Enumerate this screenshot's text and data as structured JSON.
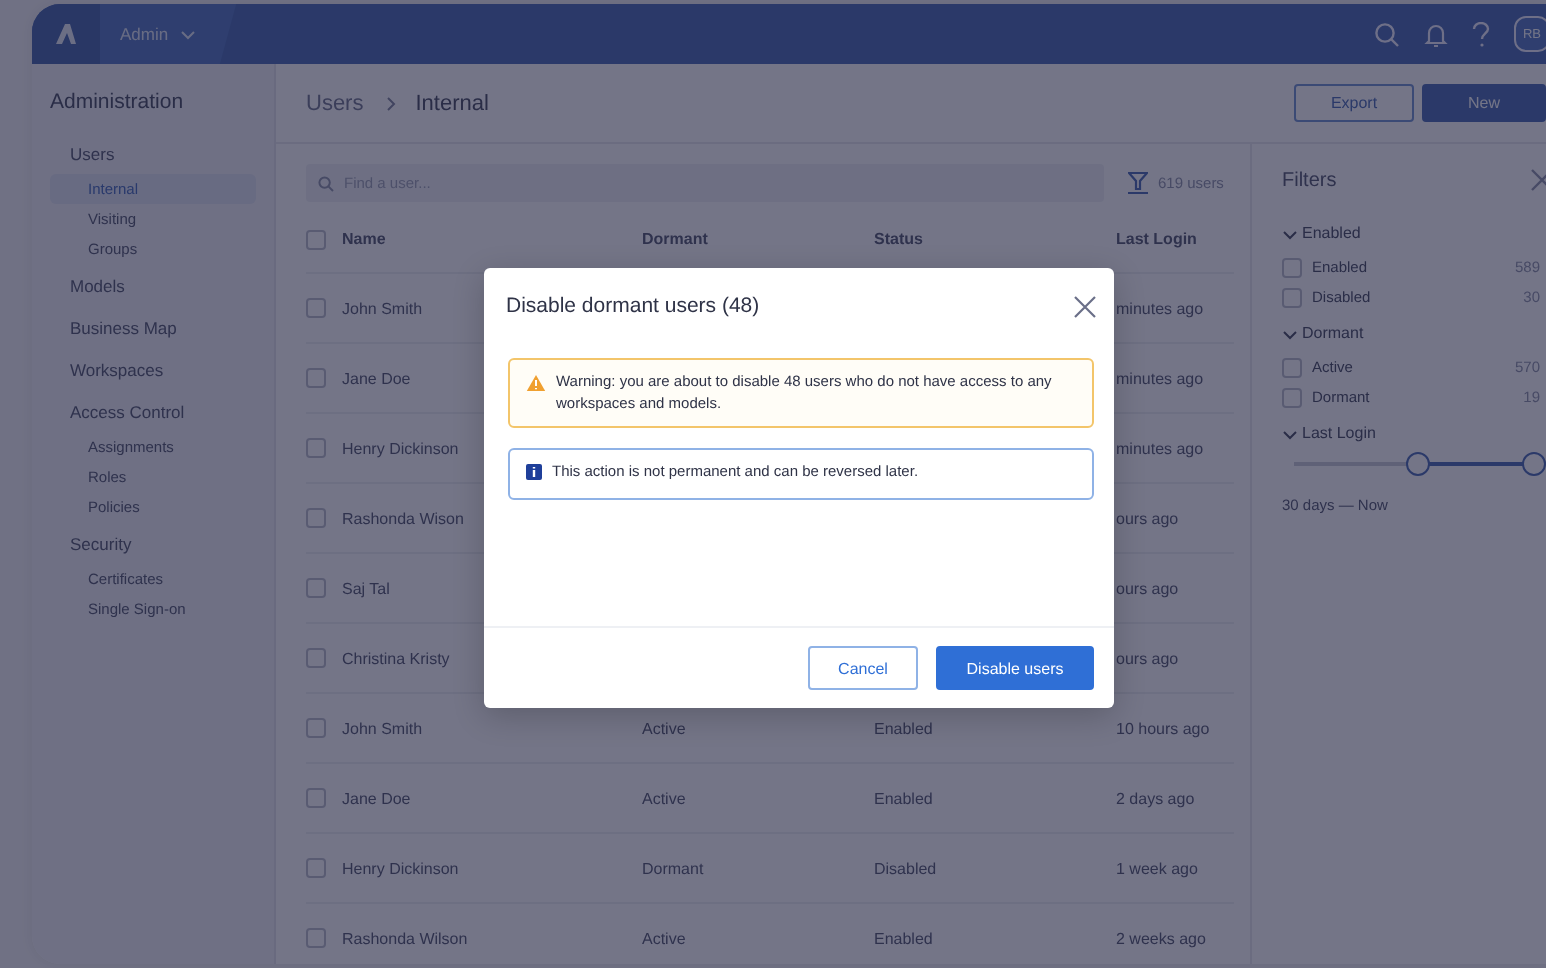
{
  "topbar": {
    "app_menu": "Admin",
    "avatar": "RB"
  },
  "sidebar": {
    "title": "Administration",
    "items": [
      {
        "label": "Users",
        "selected": false,
        "children": [
          {
            "label": "Internal",
            "selected": true
          },
          {
            "label": "Visiting",
            "selected": false
          },
          {
            "label": "Groups",
            "selected": false
          }
        ]
      },
      {
        "label": "Models",
        "selected": false
      },
      {
        "label": "Business Map",
        "selected": false
      },
      {
        "label": "Workspaces",
        "selected": false
      },
      {
        "label": "Access Control",
        "selected": false,
        "children": [
          {
            "label": "Assignments",
            "selected": false
          },
          {
            "label": "Roles",
            "selected": false
          },
          {
            "label": "Policies",
            "selected": false
          }
        ]
      },
      {
        "label": "Security",
        "selected": false,
        "children": [
          {
            "label": "Certificates",
            "selected": false
          },
          {
            "label": "Single Sign-on",
            "selected": false
          }
        ]
      }
    ]
  },
  "header": {
    "breadcrumb": [
      "Users",
      "Internal"
    ],
    "buttons": [
      {
        "label": "Export",
        "kind": "secondary"
      },
      {
        "label": "New",
        "kind": "primary"
      }
    ]
  },
  "search": {
    "placeholder": "Find a user..."
  },
  "user_count": "619 users",
  "table": {
    "columns": [
      "Name",
      "Dormant",
      "Status",
      "Last Login"
    ],
    "header_checked": false,
    "rows": [
      {
        "checked": false,
        "name": "John Smith",
        "last_login": "minutes ago"
      },
      {
        "checked": false,
        "name": "Jane Doe",
        "last_login": "minutes ago"
      },
      {
        "checked": false,
        "name": "Henry Dickinson",
        "last_login": "minutes ago"
      },
      {
        "checked": false,
        "name": "Rashonda Wison",
        "last_login": "ours ago"
      },
      {
        "checked": false,
        "name": "Saj Tal",
        "last_login": "ours ago"
      },
      {
        "checked": false,
        "name": "Christina Kristy",
        "last_login": "ours ago"
      },
      {
        "checked": false,
        "name": "John Smith",
        "dormant": "Active",
        "status": "Enabled",
        "last_login": "10 hours ago"
      },
      {
        "checked": false,
        "name": "Jane Doe",
        "dormant": "Active",
        "status": "Enabled",
        "last_login": "2 days ago"
      },
      {
        "checked": false,
        "name": "Henry Dickinson",
        "dormant": "Dormant",
        "status": "Disabled",
        "last_login": "1 week ago"
      },
      {
        "checked": false,
        "name": "Rashonda Wilson",
        "dormant": "Active",
        "status": "Enabled",
        "last_login": "2 weeks ago"
      }
    ]
  },
  "filters": {
    "title": "Filters",
    "groups": [
      {
        "kind": "checklist",
        "label": "Enabled",
        "expanded": true,
        "options": [
          {
            "label": "Enabled",
            "count": "589",
            "checked": false
          },
          {
            "label": "Disabled",
            "count": "30",
            "checked": false
          }
        ]
      },
      {
        "kind": "checklist",
        "label": "Dormant",
        "expanded": true,
        "options": [
          {
            "label": "Active",
            "count": "570",
            "checked": false
          },
          {
            "label": "Dormant",
            "count": "19",
            "checked": false
          }
        ]
      },
      {
        "kind": "range",
        "label": "Last Login",
        "expanded": true,
        "level": 0.48,
        "reading": "30 days — Now"
      }
    ]
  },
  "dialog": {
    "title": "Disable dormant users (48)",
    "messages": [
      {
        "kind": "warning",
        "text": "Warning: you are about to disable 48 users who do not have access to any workspaces and models."
      },
      {
        "kind": "info",
        "text": "This action is not permanent and can be reversed later."
      }
    ],
    "buttons": [
      {
        "label": "Cancel",
        "kind": "secondary"
      },
      {
        "label": "Disable users",
        "kind": "primary"
      }
    ]
  }
}
